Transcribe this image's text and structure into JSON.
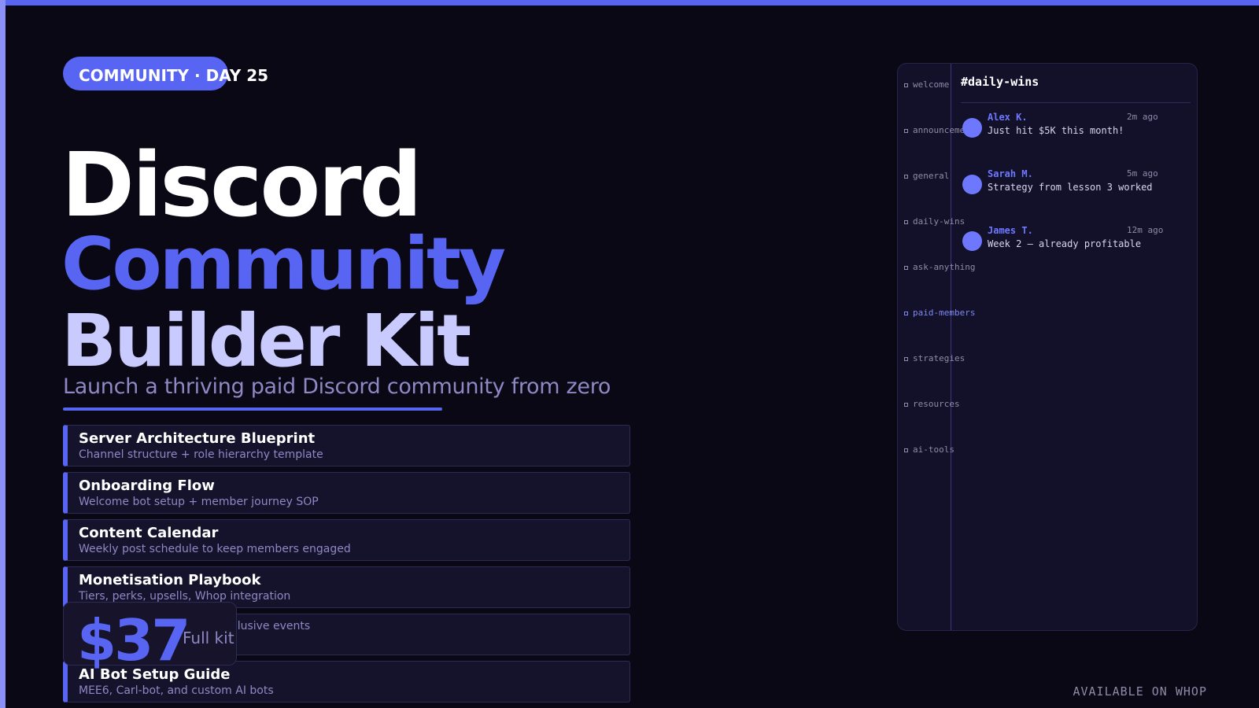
{
  "colors": {
    "accent": "#5865f2",
    "lavender": "#c9cbff",
    "muted": "#8e88c4",
    "background": "#0a0814",
    "card": "#15122b"
  },
  "badge": {
    "label": "COMMUNITY",
    "separator": "·",
    "day": "DAY 25"
  },
  "hero": {
    "line1": "Discord",
    "line2": "Community",
    "line3": "Builder Kit",
    "subtitle": "Launch a thriving paid Discord community from zero"
  },
  "features": [
    {
      "title": "Server Architecture Blueprint",
      "subtitle": "Channel structure + role hierarchy template"
    },
    {
      "title": "Onboarding Flow",
      "subtitle": "Welcome bot setup + member journey SOP"
    },
    {
      "title": "Content Calendar",
      "subtitle": "Weekly post schedule to keep members engaged"
    },
    {
      "title": "Monetisation Playbook",
      "subtitle": "Tiers, perks, upsells, Whop integration"
    },
    {
      "title": "",
      "subtitle": "clusive events"
    },
    {
      "title": "AI Bot Setup Guide",
      "subtitle": "MEE6, Carl-bot, and custom AI bots"
    }
  ],
  "pricing": {
    "price": "$37",
    "label": "Full kit"
  },
  "discord_mock": {
    "channels": [
      "welcome",
      "announcements",
      "general",
      "daily-wins",
      "ask-anything",
      "paid-members",
      "strategies",
      "resources",
      "ai-tools"
    ],
    "active_channel": "paid-members",
    "header": "#daily-wins",
    "messages": [
      {
        "author": "Alex K.",
        "time": "2m ago",
        "text": "Just hit $5K this month!"
      },
      {
        "author": "Sarah M.",
        "time": "5m ago",
        "text": "Strategy from lesson 3 worked"
      },
      {
        "author": "James T.",
        "time": "12m ago",
        "text": "Week 2 — already profitable"
      }
    ]
  },
  "footer": {
    "text": "AVAILABLE ON WHOP"
  }
}
